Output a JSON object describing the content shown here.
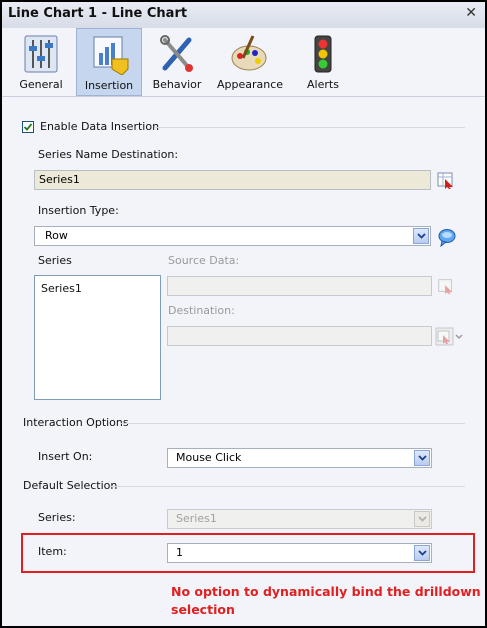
{
  "window": {
    "title": "Line Chart 1 - Line Chart",
    "close_glyph": "✕"
  },
  "tabs": [
    {
      "label": "General",
      "icon": "sliders-icon"
    },
    {
      "label": "Insertion",
      "icon": "chart-insert-icon",
      "active": true
    },
    {
      "label": "Behavior",
      "icon": "tools-icon"
    },
    {
      "label": "Appearance",
      "icon": "palette-icon"
    },
    {
      "label": "Alerts",
      "icon": "traffic-light-icon"
    }
  ],
  "insertion": {
    "enable_label": "Enable Data Insertion",
    "enable_checked": true,
    "series_name_destination_label": "Series Name Destination:",
    "series_name_destination_value": "Series1",
    "insertion_type_label": "Insertion Type:",
    "insertion_type_value": "Row",
    "series_label": "Series",
    "series_items": [
      "Series1"
    ],
    "source_data_label": "Source Data:",
    "destination_label": "Destination:"
  },
  "interaction": {
    "section_label": "Interaction Options",
    "insert_on_label": "Insert On:",
    "insert_on_value": "Mouse Click"
  },
  "default_selection": {
    "section_label": "Default Selection",
    "series_label": "Series:",
    "series_value": "Series1",
    "item_label": "Item:",
    "item_value": "1"
  },
  "annotation": {
    "text": "No option to dynamically bind the drilldown selection"
  },
  "colors": {
    "accent_tab": "#c6d6ef",
    "annotation_red": "#e02020"
  }
}
